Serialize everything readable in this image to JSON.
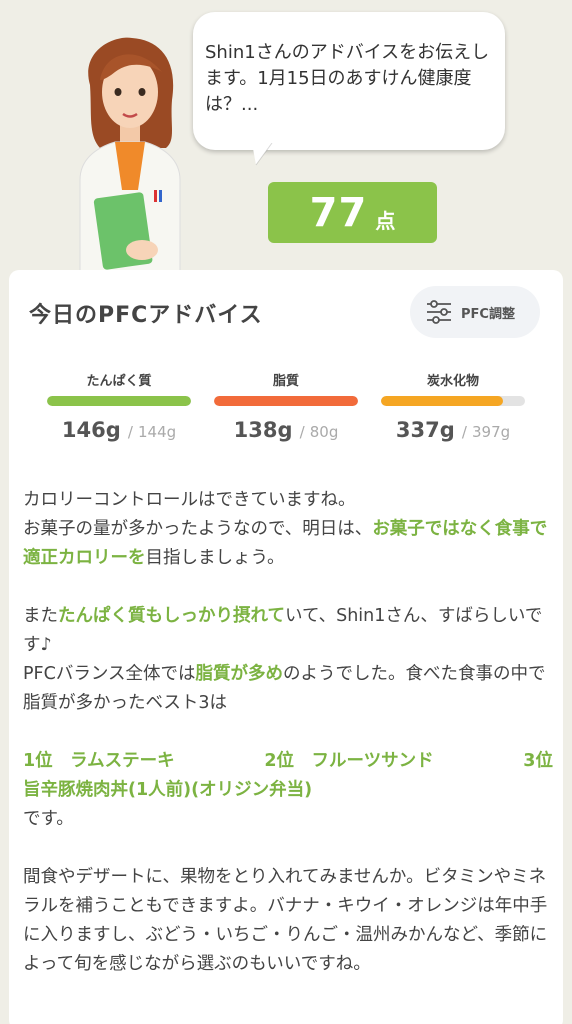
{
  "bubble": {
    "text": "Shin1さんのアドバイスをお伝えします。1月15日のあすけん健康度は？..."
  },
  "score": {
    "value": "77",
    "unit": "点"
  },
  "card": {
    "title": "今日のPFCアドバイス",
    "pfc_button_label": "PFC調整"
  },
  "macros": [
    {
      "label": "たんぱく質",
      "current": "146g",
      "sep": "/",
      "target": "144g",
      "fill": 1.0,
      "color": "#8bc34a"
    },
    {
      "label": "脂質",
      "current": "138g",
      "sep": "/",
      "target": "80g",
      "fill": 1.0,
      "color": "#f26b3a"
    },
    {
      "label": "炭水化物",
      "current": "337g",
      "sep": "/",
      "target": "397g",
      "fill": 0.85,
      "color": "#f5a623"
    }
  ],
  "advice": {
    "p1_a": "カロリーコントロールはできていますね。",
    "p1_b": "お菓子の量が多かったようなので、明日は、",
    "p1_hl": "お菓子ではなく食事で適正カロリーを",
    "p1_c": "目指しましょう。",
    "p2_a": "また",
    "p2_hl": "たんぱく質もしっかり摂れて",
    "p2_b": "いて、Shin1さん、すばらしいです♪",
    "p3_a": "PFCバランス全体では",
    "p3_hl": "脂質が多め",
    "p3_b": "のようでした。食べた食事の中で脂質が多かったベスト3は",
    "rank1": "1位　ラムステーキ",
    "rank2": "2位　フルーツサンド",
    "rank3_label": "3位",
    "rank3_item": "旨辛豚焼肉丼(1人前)(オリジン弁当)",
    "p4": "です。",
    "p5": "間食やデザートに、果物をとり入れてみませんか。ビタミンやミネラルを補うこともできますよ。バナナ・キウイ・オレンジは年中手に入りますし、ぶどう・いちご・りんご・温州みかんなど、季節によって旬を感じながら選ぶのもいいですね。"
  },
  "colors": {
    "accent_green": "#8bc34a",
    "highlight_green": "#7cb342",
    "fat_orange": "#f26b3a",
    "carb_orange": "#f5a623"
  }
}
